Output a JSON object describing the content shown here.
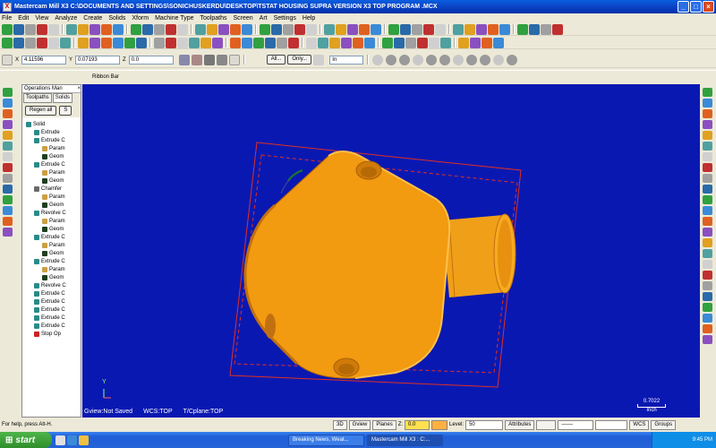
{
  "window": {
    "title": "Mastercam Mill X3  C:\\DOCUMENTS AND SETTINGS\\SONICHUSKERDU\\DESKTOP\\TSTAT HOUSING SUPRA VERSION X3 TOP PROGRAM .MCX"
  },
  "menu": [
    "File",
    "Edit",
    "View",
    "Analyze",
    "Create",
    "Solids",
    "Xform",
    "Machine Type",
    "Toolpaths",
    "Screen",
    "Art",
    "Settings",
    "Help"
  ],
  "coords": {
    "x_label": "X",
    "x_value": "4.11596",
    "y_label": "Y",
    "y_value": "0.07193",
    "z_label": "Z",
    "z_value": "0.0"
  },
  "autocursor": {
    "all_label": "All...",
    "only_label": "Only...",
    "units": "In"
  },
  "ribbon_label": "Ribbon Bar",
  "ops_manager": {
    "title": "Operations Man",
    "tabs": [
      "Toolpaths",
      "Solids"
    ],
    "regen_label": "Regen all",
    "s_label": "S",
    "tree": [
      {
        "label": "Solid",
        "level": 0,
        "color": "#2a8a8a"
      },
      {
        "label": "Extrude",
        "level": 1,
        "color": "#2a8a8a"
      },
      {
        "label": "Extrude C",
        "level": 1,
        "color": "#2a8a8a"
      },
      {
        "label": "Param",
        "level": 2,
        "color": "#cc9f44"
      },
      {
        "label": "Geom",
        "level": 2,
        "color": "#1f3f1f"
      },
      {
        "label": "Extrude C",
        "level": 1,
        "color": "#2a8a8a"
      },
      {
        "label": "Param",
        "level": 2,
        "color": "#cc9f44"
      },
      {
        "label": "Geom",
        "level": 2,
        "color": "#1f3f1f"
      },
      {
        "label": "Chamfer",
        "level": 1,
        "color": "#6a6a6a"
      },
      {
        "label": "Param",
        "level": 2,
        "color": "#cc9f44"
      },
      {
        "label": "Geom",
        "level": 2,
        "color": "#1f3f1f"
      },
      {
        "label": "Revolve C",
        "level": 1,
        "color": "#2a8a8a"
      },
      {
        "label": "Param",
        "level": 2,
        "color": "#cc9f44"
      },
      {
        "label": "Geom",
        "level": 2,
        "color": "#1f3f1f"
      },
      {
        "label": "Extrude C",
        "level": 1,
        "color": "#2a8a8a"
      },
      {
        "label": "Param",
        "level": 2,
        "color": "#cc9f44"
      },
      {
        "label": "Geom",
        "level": 2,
        "color": "#1f3f1f"
      },
      {
        "label": "Extrude C",
        "level": 1,
        "color": "#2a8a8a"
      },
      {
        "label": "Param",
        "level": 2,
        "color": "#cc9f44"
      },
      {
        "label": "Geom",
        "level": 2,
        "color": "#1f3f1f"
      },
      {
        "label": "Revolve C",
        "level": 1,
        "color": "#2a8a8a"
      },
      {
        "label": "Extrude C",
        "level": 1,
        "color": "#2a8a8a"
      },
      {
        "label": "Extrude C",
        "level": 1,
        "color": "#2a8a8a"
      },
      {
        "label": "Extrude C",
        "level": 1,
        "color": "#2a8a8a"
      },
      {
        "label": "Extrude C",
        "level": 1,
        "color": "#2a8a8a"
      },
      {
        "label": "Extrude C",
        "level": 1,
        "color": "#2a8a8a"
      },
      {
        "label": "Stop Op",
        "level": 1,
        "color": "#cc2222"
      }
    ]
  },
  "viewport": {
    "gview_label": "Gview:Not Saved",
    "wcs_label": "WCS:TOP",
    "tcplane_label": "T/Cplane:TOP",
    "scale_value": "0.7022",
    "scale_unit": "Inch",
    "axis_label": "Y",
    "bg_color": "#0a18b2",
    "part_color": "#f29a10"
  },
  "status": {
    "help_text": "For help, press Alt-H.",
    "mode_3d": "3D",
    "gview": "Gview",
    "planes": "Planes",
    "z_label": "Z:",
    "z_value": "0.0",
    "level_label": "Level:",
    "level_value": "50",
    "attributes": "Attributes",
    "wcs": "WCS",
    "groups": "Groups"
  },
  "taskbar": {
    "start_label": "start",
    "items": [
      {
        "label": "Breaking News, Weat...",
        "active": false
      },
      {
        "label": "Mastercam Mill X3 : C:...",
        "active": true
      }
    ],
    "clock": "9:45 PM"
  }
}
